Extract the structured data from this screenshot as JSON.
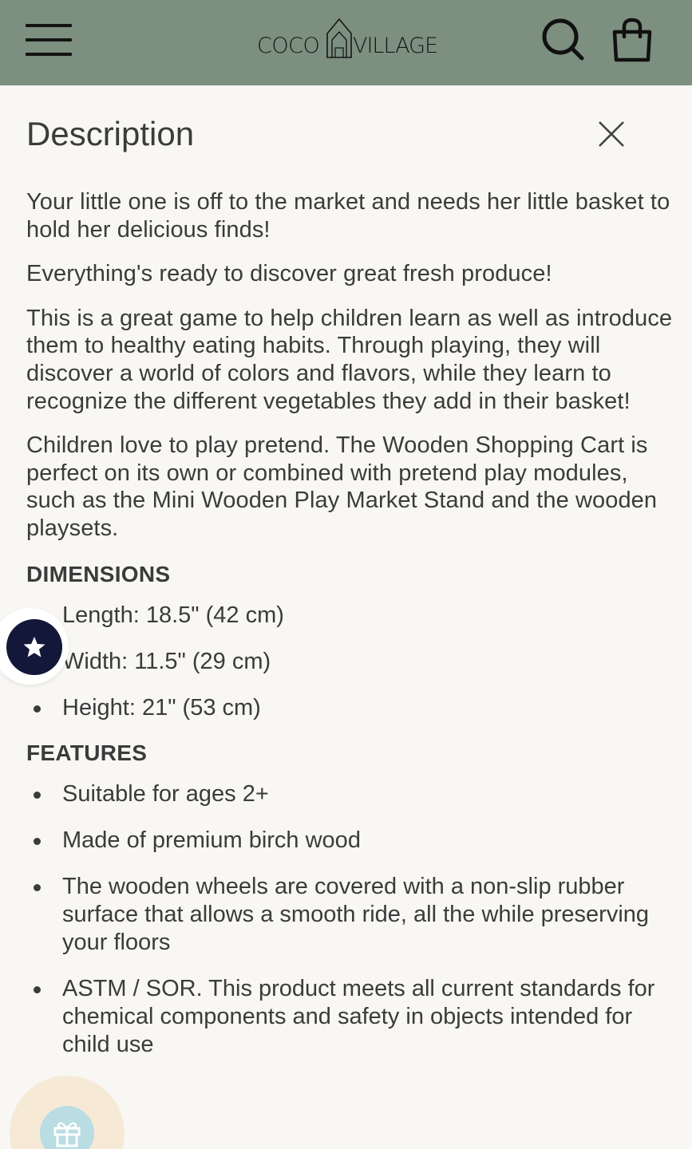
{
  "header": {
    "logo_left": "COCO",
    "logo_right": "VILLAGE",
    "background": "#7d8f7f",
    "icons": [
      "menu-icon",
      "search-icon",
      "shopping-bag-icon"
    ]
  },
  "panel": {
    "title": "Description",
    "close_icon": "close-icon",
    "paragraphs": [
      "Your little one is off to the market and needs her little basket to hold her delicious finds!",
      "Everything's ready to discover great fresh produce!",
      "This is a great game to help children learn as well as introduce them to healthy eating habits. Through playing, they will discover a world of colors and flavors, while they learn to recognize the different vegetables they add in their basket!",
      "Children love to play pretend. The Wooden Shopping Cart is perfect on its own or combined with pretend play modules, such as the Mini Wooden Play Market Stand and the wooden playsets."
    ],
    "dimensions": {
      "heading": "DIMENSIONS",
      "items": [
        "Length: 18.5\" (42 cm)",
        "Width: 11.5\" (29 cm)",
        "Height: 21\" (53 cm)"
      ]
    },
    "features": {
      "heading": "FEATURES",
      "items": [
        "Suitable for ages 2+",
        "Made of premium birch wood",
        "The wooden wheels are covered with a non-slip rubber surface that allows a smooth ride, all the while preserving your floors",
        "ASTM / SOR. This product meets all current standards for chemical components and safety in objects intended for child use"
      ]
    }
  },
  "floating": {
    "reviews_icon": "star-icon",
    "reviews_color": "#13183a",
    "rewards_icon": "gift-icon",
    "rewards_color": "#b9dde2"
  }
}
